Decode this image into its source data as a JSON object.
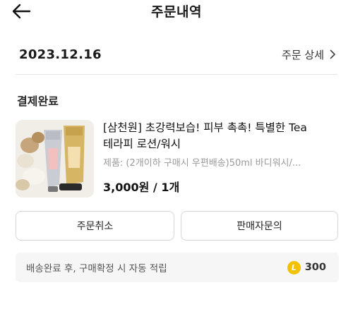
{
  "header": {
    "title": "주문내역",
    "back_icon": "arrow-left-icon"
  },
  "order": {
    "date": "2023.12.16",
    "detail_link": "주문 상세",
    "detail_icon": "chevron-right-icon",
    "status": "결제완료"
  },
  "product": {
    "name_line1": "[삼천원] 초강력보습! 피부 촉촉! 특별한 Tea",
    "name_line2": "테라피 로션/워시",
    "option": "제품: (2개이하 구매시 우편배송)50ml 바디워시/...",
    "price": "3,000원 / 1개"
  },
  "actions": {
    "cancel_label": "주문취소",
    "contact_seller_label": "판매자문의"
  },
  "reward": {
    "text": "배송완료 후, 구매확정 시 자동 적립",
    "points": "300",
    "coin_icon": "point-coin-icon",
    "coin_symbol": "L",
    "coin_color": "#F2C200"
  }
}
